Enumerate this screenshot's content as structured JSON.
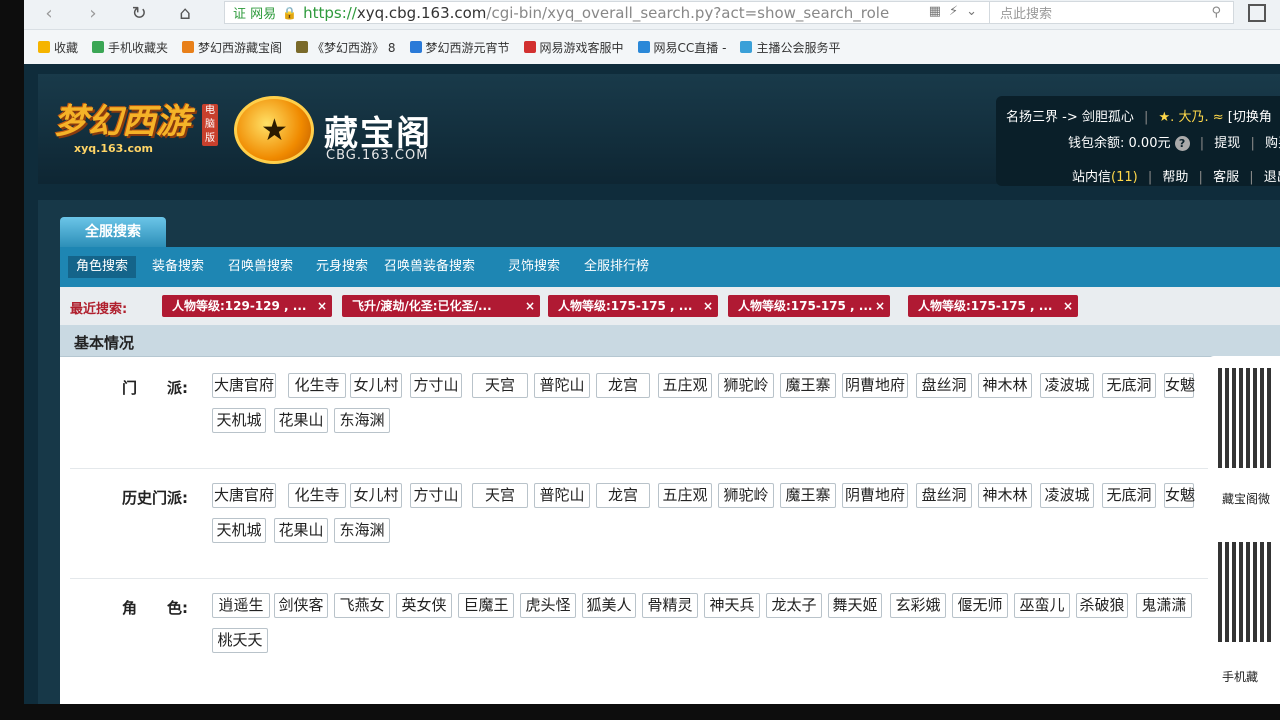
{
  "browser": {
    "cert_label": "证 网易",
    "url_proto": "https://",
    "url_host": "xyq.cbg.163.com",
    "url_path": "/cgi-bin/xyq_overall_search.py?act=show_search_role",
    "search_placeholder": "点此搜索",
    "favorites": [
      {
        "label": "收藏",
        "color": "#f5b400"
      },
      {
        "label": "手机收藏夹",
        "color": "#3aa655"
      },
      {
        "label": "梦幻西游藏宝阁",
        "color": "#e8801a"
      },
      {
        "label": "《梦幻西游》 8",
        "color": "#7a6a2a"
      },
      {
        "label": "梦幻西游元宵节",
        "color": "#2a7ad8"
      },
      {
        "label": "网易游戏客服中",
        "color": "#d23030"
      },
      {
        "label": "网易CC直播 -",
        "color": "#2a88d8"
      },
      {
        "label": "主播公会服务平",
        "color": "#3aa0d8"
      }
    ]
  },
  "header": {
    "game_logo_text": "梦幻西游",
    "game_logo_sub": "xyq.163.com",
    "game_badge": "电脑版",
    "site_name": "藏宝阁",
    "site_domain": "CBG.163.COM"
  },
  "user": {
    "server": "名扬三界 -> 剑胆孤心",
    "nickname": "★. 大乃. ≈",
    "switch": "[切换角",
    "wallet_label": "钱包余额:",
    "wallet_value": "0.00元",
    "withdraw": "提现",
    "buy": "购买",
    "messages": "站内信",
    "message_count": "(11)",
    "help": "帮助",
    "service": "客服",
    "logout": "退出"
  },
  "tabs": {
    "main": "全服搜索",
    "sub": [
      "角色搜索",
      "装备搜索",
      "召唤兽搜索",
      "元身搜索",
      "召唤兽装备搜索",
      "灵饰搜索",
      "全服排行榜"
    ]
  },
  "recent": {
    "label": "最近搜索:",
    "chips": [
      "人物等级:129-129 , ...",
      "飞升/渡劫/化圣:已化圣/...",
      "人物等级:175-175 , ...",
      "人物等级:175-175 , ...",
      "人物等级:175-175 , ..."
    ],
    "close": "×"
  },
  "filter": {
    "section_title": "基本情况",
    "rows": [
      {
        "label": "门　　派:",
        "options": [
          "大唐官府",
          "化生寺",
          "女儿村",
          "方寸山",
          "天宫",
          "普陀山",
          "龙宫",
          "五庄观",
          "狮驼岭",
          "魔王寨",
          "阴曹地府",
          "盘丝洞",
          "神木林",
          "凌波城",
          "无底洞",
          "女魃",
          "天机城",
          "花果山",
          "东海渊"
        ]
      },
      {
        "label": "历史门派:",
        "options": [
          "大唐官府",
          "化生寺",
          "女儿村",
          "方寸山",
          "天宫",
          "普陀山",
          "龙宫",
          "五庄观",
          "狮驼岭",
          "魔王寨",
          "阴曹地府",
          "盘丝洞",
          "神木林",
          "凌波城",
          "无底洞",
          "女魃",
          "天机城",
          "花果山",
          "东海渊"
        ]
      },
      {
        "label": "角　　色:",
        "options": [
          "逍遥生",
          "剑侠客",
          "飞燕女",
          "英女侠",
          "巨魔王",
          "虎头怪",
          "狐美人",
          "骨精灵",
          "神天兵",
          "龙太子",
          "舞天姬",
          "玄彩娥",
          "偃无师",
          "巫蛮儿",
          "杀破狼",
          "鬼潇潇",
          "桃夭夭"
        ]
      }
    ]
  },
  "side": {
    "qr1_label": "藏宝阁微",
    "qr2_label": "手机藏"
  }
}
